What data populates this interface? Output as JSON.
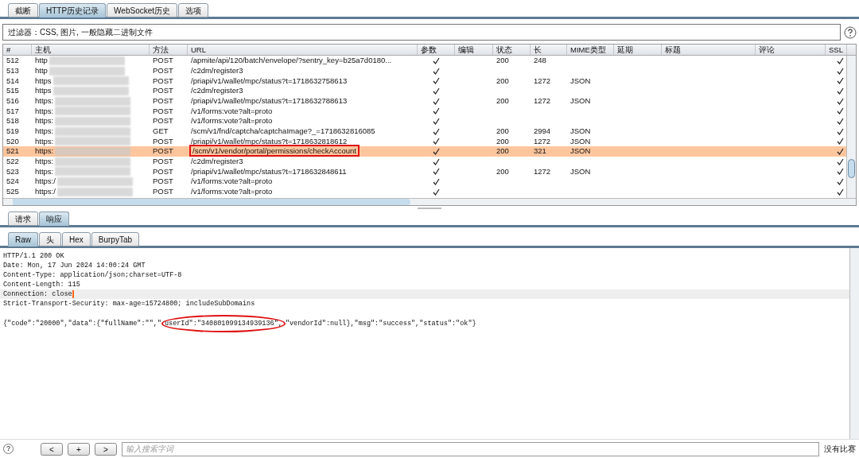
{
  "tabs": [
    {
      "label": "截断",
      "selected": false
    },
    {
      "label": "HTTP历史记录",
      "selected": true
    },
    {
      "label": "WebSocket历史",
      "selected": false
    },
    {
      "label": "选项",
      "selected": false
    }
  ],
  "filter": "过滤器：CSS, 图片, 一般隐藏二进制文件",
  "table": {
    "columns": [
      "#",
      "主机",
      "方法",
      "URL",
      "参数",
      "编辑",
      "状态",
      "长",
      "MIME类型",
      "延期",
      "标题",
      "评论",
      "SSL"
    ],
    "rows": [
      {
        "num": "512",
        "host": "http",
        "method": "POST",
        "url": "/apmite/api/120/batch/envelope/?sentry_key=b25a7d0180...",
        "params": true,
        "status": "200",
        "length": "248",
        "mime": "",
        "ssl": true,
        "selected": false,
        "boxed": false
      },
      {
        "num": "513",
        "host": "http",
        "method": "POST",
        "url": "/c2dm/register3",
        "params": true,
        "status": "",
        "length": "",
        "mime": "",
        "ssl": true,
        "selected": false,
        "boxed": false
      },
      {
        "num": "514",
        "host": "https",
        "method": "POST",
        "url": "/priapi/v1/wallet/mpc/status?t=1718632758613",
        "params": true,
        "status": "200",
        "length": "1272",
        "mime": "JSON",
        "ssl": true,
        "selected": false,
        "boxed": false
      },
      {
        "num": "515",
        "host": "https",
        "method": "POST",
        "url": "/c2dm/register3",
        "params": true,
        "status": "",
        "length": "",
        "mime": "",
        "ssl": true,
        "selected": false,
        "boxed": false
      },
      {
        "num": "516",
        "host": "https:",
        "method": "POST",
        "url": "/priapi/v1/wallet/mpc/status?t=1718632788613",
        "params": true,
        "status": "200",
        "length": "1272",
        "mime": "JSON",
        "ssl": true,
        "selected": false,
        "boxed": false
      },
      {
        "num": "517",
        "host": "https:",
        "method": "POST",
        "url": "/v1/forms:vote?alt=proto",
        "params": true,
        "status": "",
        "length": "",
        "mime": "",
        "ssl": true,
        "selected": false,
        "boxed": false
      },
      {
        "num": "518",
        "host": "https:",
        "method": "POST",
        "url": "/v1/forms:vote?alt=proto",
        "params": true,
        "status": "",
        "length": "",
        "mime": "",
        "ssl": true,
        "selected": false,
        "boxed": false
      },
      {
        "num": "519",
        "host": "https:",
        "method": "GET",
        "url": "/scm/v1/fnd/captcha/captchaImage?_=1718632816085",
        "params": true,
        "status": "200",
        "length": "2994",
        "mime": "JSON",
        "ssl": true,
        "selected": false,
        "boxed": false
      },
      {
        "num": "520",
        "host": "https:",
        "method": "POST",
        "url": "/priapi/v1/wallet/mpc/status?t=1718632818612",
        "params": true,
        "status": "200",
        "length": "1272",
        "mime": "JSON",
        "ssl": true,
        "selected": false,
        "boxed": false
      },
      {
        "num": "521",
        "host": "https:",
        "method": "POST",
        "url": "/scm/v1/vendor/portal/permissions/checkAccount",
        "params": true,
        "status": "200",
        "length": "321",
        "mime": "JSON",
        "ssl": true,
        "selected": true,
        "boxed": true
      },
      {
        "num": "522",
        "host": "https:",
        "method": "POST",
        "url": "/c2dm/register3",
        "params": true,
        "status": "",
        "length": "",
        "mime": "",
        "ssl": true,
        "selected": false,
        "boxed": false
      },
      {
        "num": "523",
        "host": "https:",
        "method": "POST",
        "url": "/priapi/v1/wallet/mpc/status?t=1718632848611",
        "params": true,
        "status": "200",
        "length": "1272",
        "mime": "JSON",
        "ssl": true,
        "selected": false,
        "boxed": false
      },
      {
        "num": "524",
        "host": "https:/",
        "method": "POST",
        "url": "/v1/forms:vote?alt=proto",
        "params": true,
        "status": "",
        "length": "",
        "mime": "",
        "ssl": true,
        "selected": false,
        "boxed": false
      },
      {
        "num": "525",
        "host": "https:/",
        "method": "POST",
        "url": "/v1/forms:vote?alt=proto",
        "params": true,
        "status": "",
        "length": "",
        "mime": "",
        "ssl": true,
        "selected": false,
        "boxed": false
      }
    ]
  },
  "message_tabs": [
    {
      "label": "请求",
      "selected": false
    },
    {
      "label": "响应",
      "selected": true
    }
  ],
  "view_tabs": [
    {
      "label": "Raw",
      "selected": true
    },
    {
      "label": "头",
      "selected": false
    },
    {
      "label": "Hex",
      "selected": false
    },
    {
      "label": "BurpyTab",
      "selected": false
    }
  ],
  "response_lines": [
    {
      "text": "HTTP/1.1 200 OK",
      "current": false
    },
    {
      "text": "Date: Mon, 17 Jun 2024 14:00:24 GMT",
      "current": false
    },
    {
      "text": "Content-Type: application/json;charset=UTF-8",
      "current": false
    },
    {
      "text": "Content-Length: 115",
      "current": false
    },
    {
      "text": "Connection: close",
      "current": true
    },
    {
      "text": "Strict-Transport-Security: max-age=15724800; includeSubDomains",
      "current": false
    }
  ],
  "response_body": {
    "before": "{\"code\":\"20000\",\"data\":{\"fullName\":\"\",\"",
    "circled": "userId\":\"340801099134939136\",",
    "after": "\"vendorId\":null},\"msg\":\"success\",\"status\":\"ok\"}"
  },
  "search": {
    "help": "?",
    "buttons": [
      "<",
      "+",
      ">"
    ],
    "placeholder": "输入搜索字词",
    "matches": "没有比赛"
  }
}
